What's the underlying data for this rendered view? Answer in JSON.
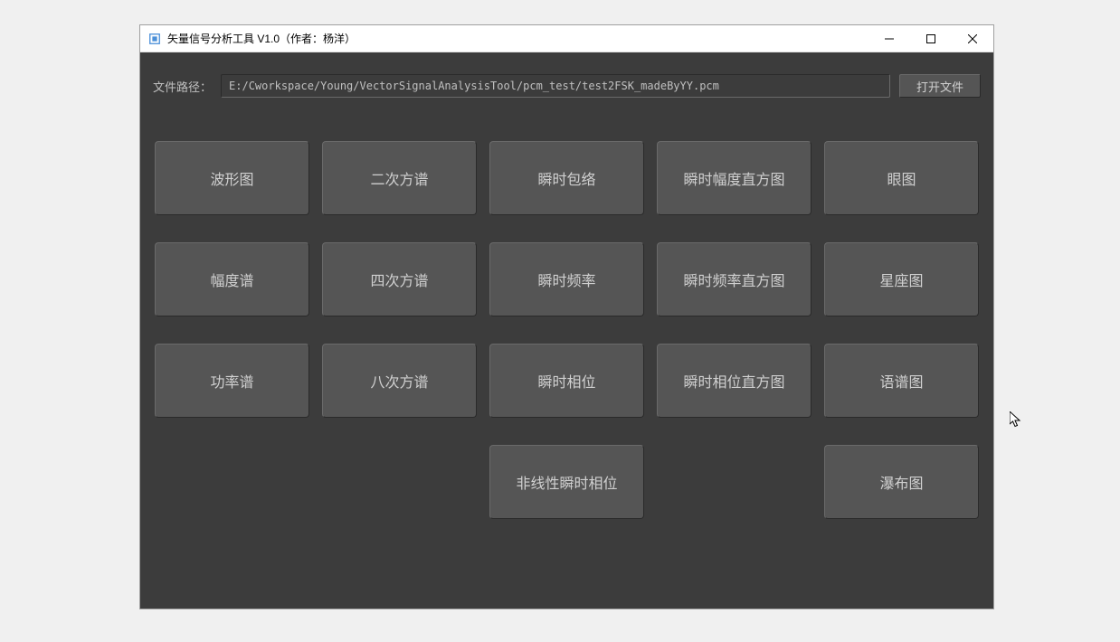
{
  "window": {
    "title": "矢量信号分析工具 V1.0（作者：杨洋）"
  },
  "filepath": {
    "label": "文件路径：",
    "value": "E:/Cworkspace/Young/VectorSignalAnalysisTool/pcm_test/test2FSK_madeByYY.pcm",
    "open_button": "打开文件"
  },
  "buttons": {
    "r0c0": "波形图",
    "r0c1": "二次方谱",
    "r0c2": "瞬时包络",
    "r0c3": "瞬时幅度直方图",
    "r0c4": "眼图",
    "r1c0": "幅度谱",
    "r1c1": "四次方谱",
    "r1c2": "瞬时频率",
    "r1c3": "瞬时频率直方图",
    "r1c4": "星座图",
    "r2c0": "功率谱",
    "r2c1": "八次方谱",
    "r2c2": "瞬时相位",
    "r2c3": "瞬时相位直方图",
    "r2c4": "语谱图",
    "r3c2": "非线性瞬时相位",
    "r3c4": "瀑布图"
  }
}
